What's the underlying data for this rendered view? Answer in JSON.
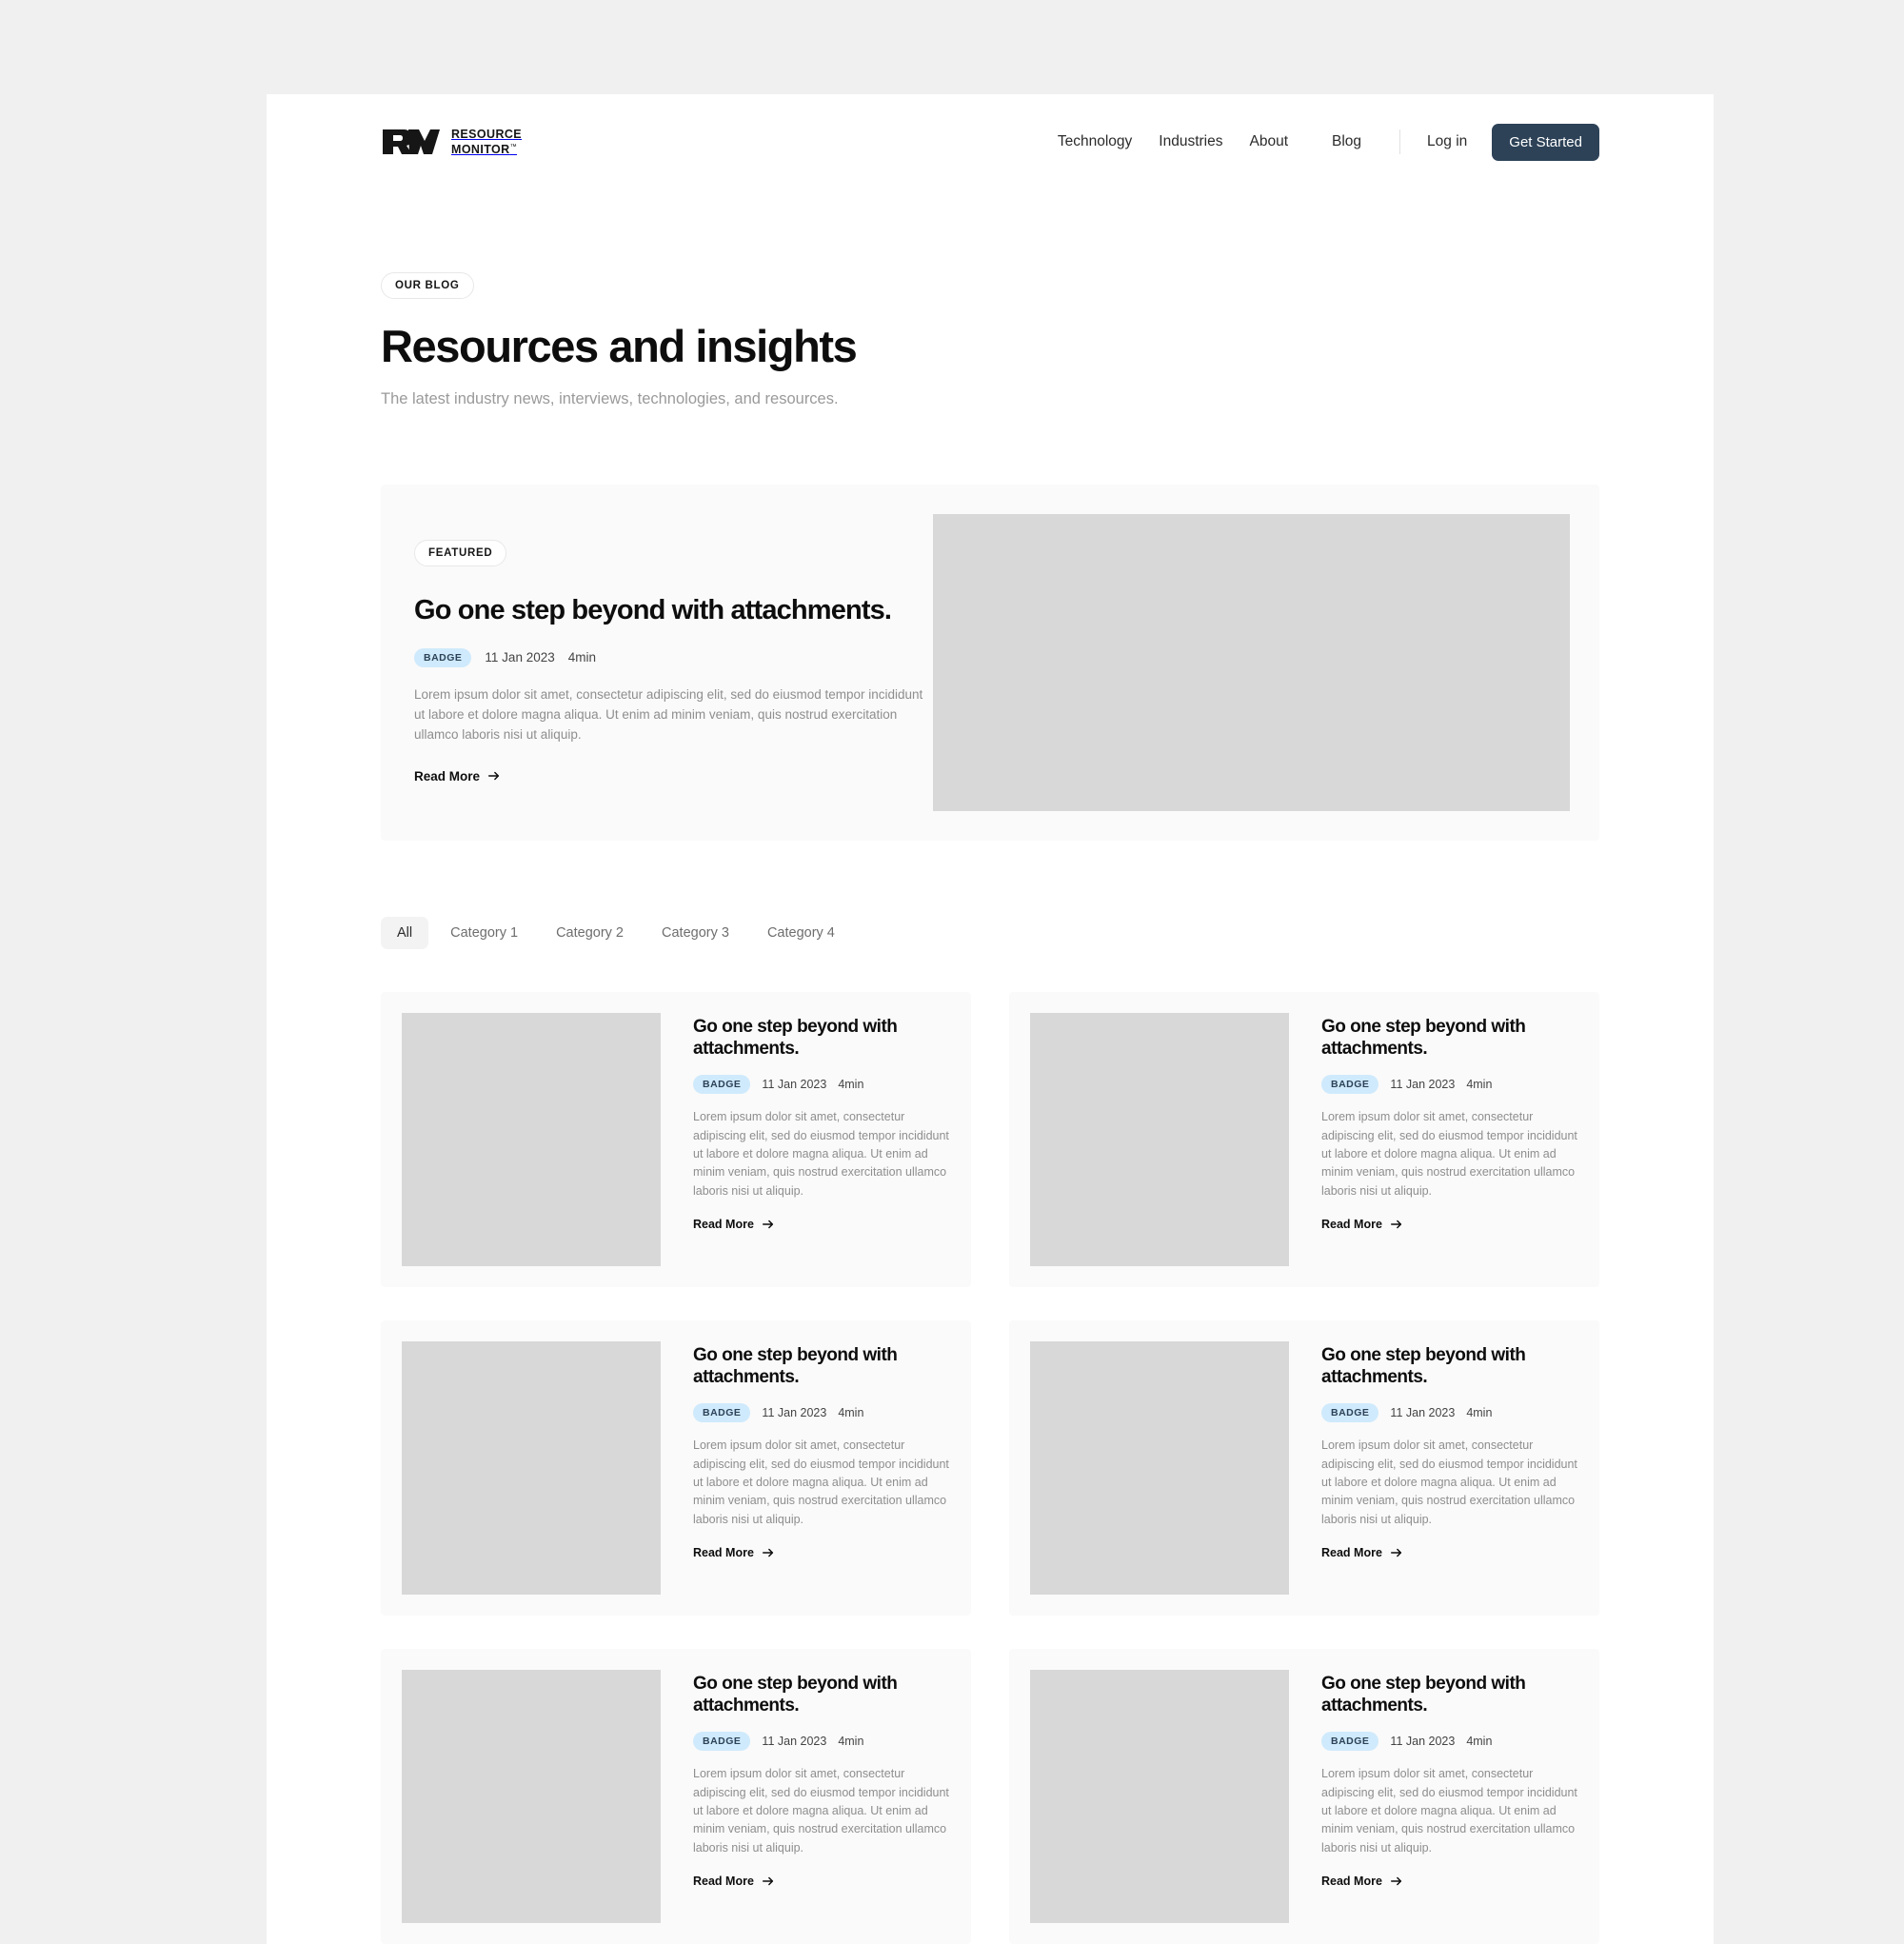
{
  "brand": {
    "mark": "rm-monogram",
    "name_line1": "RESOURCE",
    "name_line2": "MONITOR",
    "trademark": "™"
  },
  "nav": {
    "links": [
      {
        "label": "Technology"
      },
      {
        "label": "Industries"
      },
      {
        "label": "About"
      },
      {
        "label": "Blog"
      }
    ],
    "login_label": "Log in",
    "cta_label": "Get Started",
    "cta_color": "#2d4257"
  },
  "hero": {
    "eyebrow": "OUR BLOG",
    "title": "Resources and insights",
    "subtitle": "The latest industry news, interviews, technologies, and resources."
  },
  "featured": {
    "tag": "FEATURED",
    "title": "Go one step beyond with attachments.",
    "badge": "BADGE",
    "date": "11 Jan 2023",
    "read_time": "4min",
    "description": "Lorem ipsum dolor sit amet, consectetur adipiscing elit, sed do eiusmod tempor incididunt ut labore et dolore magna aliqua. Ut enim ad minim veniam, quis nostrud exercitation ullamco laboris nisi ut aliquip.",
    "read_more": "Read More",
    "image": "featured-image-placeholder"
  },
  "tabs": [
    {
      "label": "All",
      "active": true
    },
    {
      "label": "Category 1",
      "active": false
    },
    {
      "label": "Category 2",
      "active": false
    },
    {
      "label": "Category 3",
      "active": false
    },
    {
      "label": "Category 4",
      "active": false
    }
  ],
  "posts": [
    {
      "title": "Go one step beyond with attachments.",
      "badge": "BADGE",
      "date": "11 Jan 2023",
      "read_time": "4min",
      "description": "Lorem ipsum dolor sit amet, consectetur adipiscing elit, sed do eiusmod tempor incididunt ut labore et dolore magna aliqua. Ut enim ad minim veniam, quis nostrud exercitation ullamco laboris nisi ut aliquip.",
      "read_more": "Read More"
    },
    {
      "title": "Go one step beyond with attachments.",
      "badge": "BADGE",
      "date": "11 Jan 2023",
      "read_time": "4min",
      "description": "Lorem ipsum dolor sit amet, consectetur adipiscing elit, sed do eiusmod tempor incididunt ut labore et dolore magna aliqua. Ut enim ad minim veniam, quis nostrud exercitation ullamco laboris nisi ut aliquip.",
      "read_more": "Read More"
    },
    {
      "title": "Go one step beyond with attachments.",
      "badge": "BADGE",
      "date": "11 Jan 2023",
      "read_time": "4min",
      "description": "Lorem ipsum dolor sit amet, consectetur adipiscing elit, sed do eiusmod tempor incididunt ut labore et dolore magna aliqua. Ut enim ad minim veniam, quis nostrud exercitation ullamco laboris nisi ut aliquip.",
      "read_more": "Read More"
    },
    {
      "title": "Go one step beyond with attachments.",
      "badge": "BADGE",
      "date": "11 Jan 2023",
      "read_time": "4min",
      "description": "Lorem ipsum dolor sit amet, consectetur adipiscing elit, sed do eiusmod tempor incididunt ut labore et dolore magna aliqua. Ut enim ad minim veniam, quis nostrud exercitation ullamco laboris nisi ut aliquip.",
      "read_more": "Read More"
    },
    {
      "title": "Go one step beyond with attachments.",
      "badge": "BADGE",
      "date": "11 Jan 2023",
      "read_time": "4min",
      "description": "Lorem ipsum dolor sit amet, consectetur adipiscing elit, sed do eiusmod tempor incididunt ut labore et dolore magna aliqua. Ut enim ad minim veniam, quis nostrud exercitation ullamco laboris nisi ut aliquip.",
      "read_more": "Read More"
    },
    {
      "title": "Go one step beyond with attachments.",
      "badge": "BADGE",
      "date": "11 Jan 2023",
      "read_time": "4min",
      "description": "Lorem ipsum dolor sit amet, consectetur adipiscing elit, sed do eiusmod tempor incididunt ut labore et dolore magna aliqua. Ut enim ad minim veniam, quis nostrud exercitation ullamco laboris nisi ut aliquip.",
      "read_more": "Read More"
    }
  ],
  "colors": {
    "page_bg": "#ffffff",
    "outer_bg": "#f0f0f0",
    "card_bg": "#fafafa",
    "image_placeholder": "#d8d8d8",
    "badge_bg": "#cfeafc",
    "badge_text": "#2d4257"
  }
}
